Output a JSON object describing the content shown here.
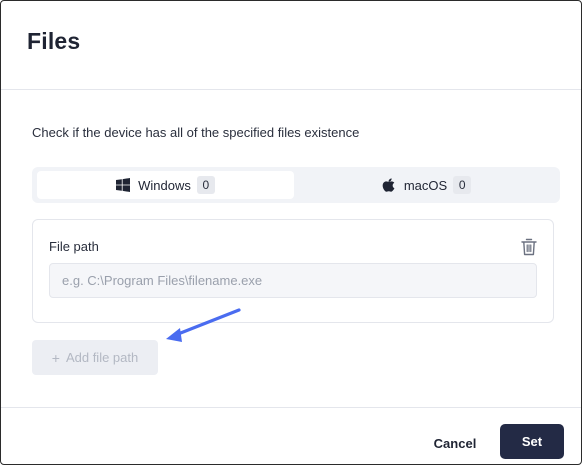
{
  "dialog": {
    "title": "Files",
    "description": "Check if the device has all of the specified files existence"
  },
  "tabs": [
    {
      "label": "Windows",
      "count": "0",
      "icon": "windows-icon",
      "selected": true
    },
    {
      "label": "macOS",
      "count": "0",
      "icon": "apple-icon",
      "selected": false
    }
  ],
  "file_entry": {
    "label": "File path",
    "value": "",
    "placeholder": "e.g. C:\\Program Files\\filename.exe",
    "delete_icon": "trash-icon"
  },
  "add_button": {
    "icon": "plus-icon",
    "label": "Add file path"
  },
  "annotation": {
    "icon": "pointer-arrow-icon",
    "color": "#4a6cf0"
  },
  "footer": {
    "cancel_label": "Cancel",
    "set_label": "Set"
  },
  "colors": {
    "primary": "#232a45",
    "annotation": "#4a6cf0"
  }
}
